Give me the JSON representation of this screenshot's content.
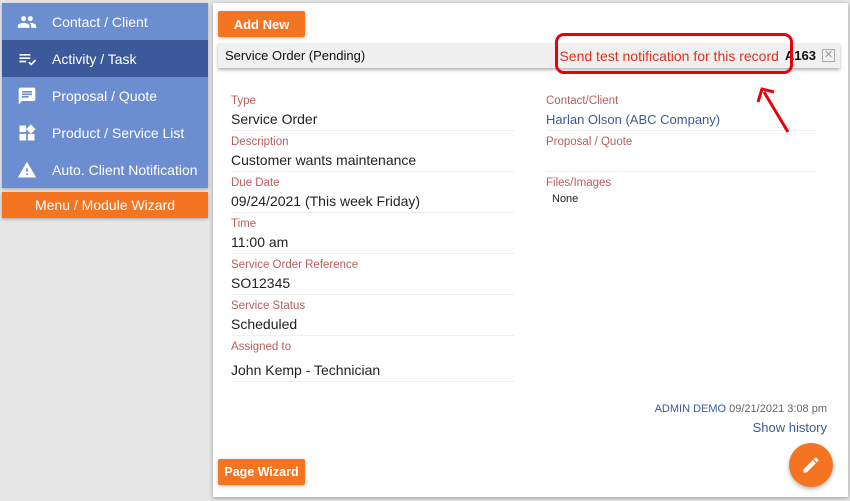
{
  "sidebar": {
    "items": [
      {
        "label": "Contact / Client",
        "icon": "people-icon",
        "active": false
      },
      {
        "label": "Activity / Task",
        "icon": "checklist-icon",
        "active": true
      },
      {
        "label": "Proposal / Quote",
        "icon": "comment-icon",
        "active": false
      },
      {
        "label": "Product / Service List",
        "icon": "widgets-icon",
        "active": false
      },
      {
        "label": "Auto. Client Notification",
        "icon": "warning-icon",
        "active": false
      }
    ],
    "wizard_label": "Menu / Module Wizard"
  },
  "main": {
    "add_new_label": "Add New",
    "record_title": "Service Order (Pending)",
    "notify_label": "Send test notification for this record",
    "record_id": "A163",
    "close_symbol": "✕",
    "left_fields": [
      {
        "label": "Type",
        "value": "Service Order"
      },
      {
        "label": "Description",
        "value": "Customer wants maintenance"
      },
      {
        "label": "Due Date",
        "value": "09/24/2021 (This week Friday)"
      },
      {
        "label": "Time",
        "value": "11:00 am"
      },
      {
        "label": "Service Order Reference",
        "value": "SO12345"
      },
      {
        "label": "Service Status",
        "value": "Scheduled"
      },
      {
        "label": "Assigned to",
        "value": "John Kemp - Technician"
      }
    ],
    "right_fields": [
      {
        "label": "Contact/Client",
        "value": "Harlan Olson (ABC Company)"
      },
      {
        "label": "Proposal / Quote",
        "value": ""
      },
      {
        "label": "Files/Images",
        "value": "None"
      }
    ],
    "audit_user": "ADMIN DEMO",
    "audit_time": "09/21/2021 3:08 pm",
    "history_label": "Show history",
    "page_wizard_label": "Page Wizard"
  },
  "colors": {
    "accent": "#f37421",
    "sidebar": "#6c8dd0",
    "sidebar_active": "#3c5a9a",
    "label": "#b85c5c",
    "highlight": "#e8000b"
  }
}
